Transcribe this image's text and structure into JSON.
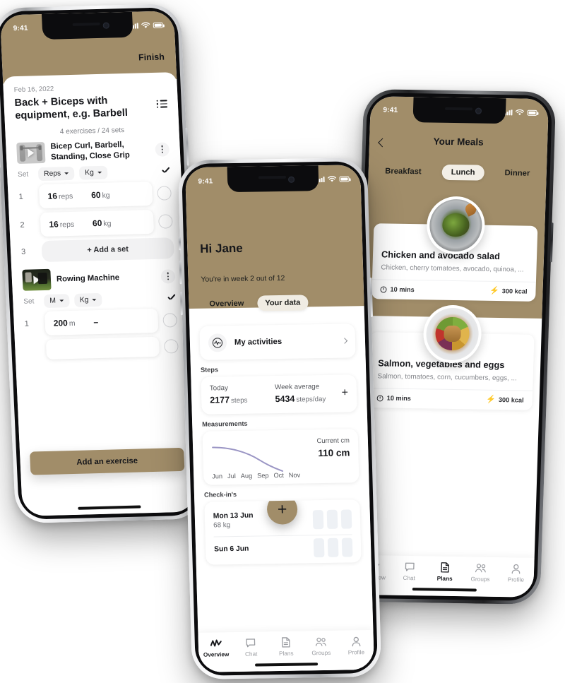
{
  "theme": {
    "tan": "#a18d69",
    "ink": "#16171b",
    "muted": "#85878c",
    "bolt_yellow": "#efc020"
  },
  "phone1": {
    "status": {
      "time": "9:41"
    },
    "finish_label": "Finish",
    "date": "Feb 16, 2022",
    "title": "Back + Biceps with equipment, e.g. Barbell",
    "meta": "4 exercises / 24 sets",
    "exercises": [
      {
        "name": "Bicep Curl, Barbell, Standing, Close Grip",
        "thumb": "anatomy-barbell-video-thumbnail",
        "set_label": "Set",
        "unit_primary": "Reps",
        "unit_secondary": "Kg",
        "sets": [
          {
            "index": "1",
            "value": "16",
            "unit": "reps",
            "weight": "60",
            "weight_unit": "kg"
          },
          {
            "index": "2",
            "value": "16",
            "unit": "reps",
            "weight": "60",
            "weight_unit": "kg"
          }
        ],
        "add_set": {
          "index": "3",
          "label": "+ Add a set"
        }
      },
      {
        "name": "Rowing Machine",
        "thumb": "gym-rowing-video-thumbnail",
        "set_label": "Set",
        "unit_primary": "M",
        "unit_secondary": "Kg",
        "sets": [
          {
            "index": "1",
            "value": "200",
            "unit": "m",
            "weight": "–",
            "weight_unit": ""
          }
        ]
      }
    ],
    "add_exercise_label": "Add an exercise"
  },
  "phone2": {
    "status": {
      "time": "9:41"
    },
    "greeting": "Hi Jane",
    "subtitle": "You're in week 2 out of 12",
    "tabs": [
      {
        "label": "Overview",
        "active": false
      },
      {
        "label": "Your data",
        "active": true
      }
    ],
    "activities": {
      "label": "My activities",
      "icon": "activity-pulse-icon"
    },
    "steps": {
      "section_label": "Steps",
      "today_caption": "Today",
      "today_value": "2177",
      "today_unit": "steps",
      "week_caption": "Week average",
      "week_value": "5434",
      "week_unit": "steps/day",
      "add_label": "+"
    },
    "measurements": {
      "section_label": "Measurements",
      "current_caption": "Current cm",
      "current_value": "110 cm",
      "months": [
        "Jun",
        "Jul",
        "Aug",
        "Sep",
        "Oct",
        "Nov"
      ]
    },
    "checkins": {
      "section_label": "Check-in's",
      "rows": [
        {
          "date": "Mon 13 Jun",
          "weight": "68 kg"
        },
        {
          "date": "Sun 6 Jun",
          "weight": ""
        }
      ],
      "fab_label": "+"
    },
    "nav": [
      {
        "label": "Overview",
        "icon": "activity-pulse-icon",
        "active": true
      },
      {
        "label": "Chat",
        "icon": "chat-bubble-icon",
        "active": false
      },
      {
        "label": "Plans",
        "icon": "document-icon",
        "active": false
      },
      {
        "label": "Groups",
        "icon": "people-icon",
        "active": false
      },
      {
        "label": "Profile",
        "icon": "person-icon",
        "active": false
      }
    ]
  },
  "phone3": {
    "status": {
      "time": "9:41"
    },
    "title": "Your Meals",
    "back_icon": "chevron-left-icon",
    "segments": [
      {
        "label": "Breakfast",
        "active": false
      },
      {
        "label": "Lunch",
        "active": true
      },
      {
        "label": "Dinner",
        "active": false
      }
    ],
    "meals": [
      {
        "title": "Chicken and avocado salad",
        "ingredients": "Chicken, cherry tomatoes, avocado, quinoa, ...",
        "time": "10 mins",
        "kcal": "300 kcal",
        "image": "chicken-avocado-salad-photo"
      },
      {
        "title": "Salmon, vegetables and eggs",
        "ingredients": "Salmon, tomatoes, corn, cucumbers, eggs, ...",
        "time": "10 mins",
        "kcal": "300 kcal",
        "image": "salmon-vegetables-eggs-photo"
      }
    ],
    "nav": [
      {
        "label": "Overview",
        "icon": "activity-pulse-icon",
        "active": false
      },
      {
        "label": "Chat",
        "icon": "chat-bubble-icon",
        "active": false
      },
      {
        "label": "Plans",
        "icon": "document-icon",
        "active": true
      },
      {
        "label": "Groups",
        "icon": "people-icon",
        "active": false
      },
      {
        "label": "Profile",
        "icon": "person-icon",
        "active": false
      }
    ]
  }
}
